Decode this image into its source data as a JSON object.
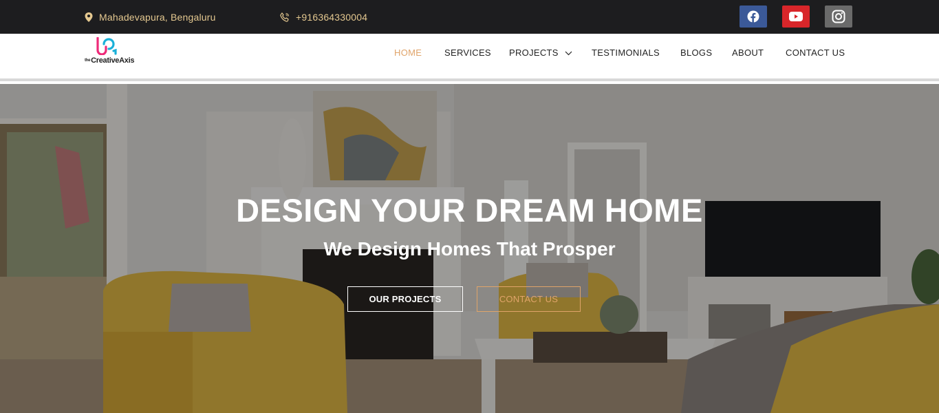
{
  "topbar": {
    "location": "Mahadevapura, Bengaluru",
    "phone": "+916364330004",
    "social": [
      "facebook-icon",
      "youtube-icon",
      "instagram-icon"
    ]
  },
  "logo": {
    "prefix": "the",
    "brand": "CreativeAxis"
  },
  "nav": {
    "items": [
      "HOME",
      "SERVICES",
      "PROJECTS",
      "TESTIMONIALS",
      "BLOGS",
      "ABOUT",
      "CONTACT US"
    ],
    "active": "HOME"
  },
  "hero": {
    "title": "DESIGN YOUR DREAM HOME",
    "subtitle": "We Design Homes That Prosper",
    "primary_button": "OUR PROJECTS",
    "secondary_button": "CONTACT US"
  },
  "colors": {
    "topbar_bg": "#1d1d1f",
    "accent": "#e0a46a",
    "facebook": "#3b5998",
    "youtube": "#d8262a",
    "instagram": "#6a6a6a"
  }
}
